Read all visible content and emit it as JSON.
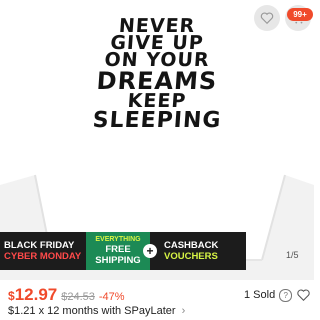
{
  "product_image": {
    "print_lines": [
      "NEVER",
      "GIVE UP",
      "ON YOUR",
      "DREAMS",
      "KEEP",
      "SLEEPING"
    ],
    "page_indicator": "1/5"
  },
  "header": {
    "cart_badge": "99+",
    "icons": [
      "heart-icon",
      "cart-icon"
    ]
  },
  "promo_banner": {
    "event_line1": "BLACK FRIDAY",
    "event_line2": "CYBER MONDAY",
    "shipping_line1": "EVERYTHING",
    "shipping_line2": "FREE",
    "shipping_line3": "SHIPPING",
    "plus": "+",
    "cashback_line1": "CASHBACK",
    "cashback_line2": "VOUCHERS",
    "colors": {
      "background": "#1c1c1c",
      "shipping_bg": "#1c8a55",
      "accent_yellow": "#d8f545",
      "accent_red": "#ff4a4a"
    }
  },
  "price": {
    "currency": "$",
    "current": "12.97",
    "original": "$24.53",
    "discount": "-47%",
    "color": "#f04a2b"
  },
  "sales": {
    "sold": "1 Sold",
    "help_symbol": "?"
  },
  "installment": {
    "text": "$1.21 x 12 months with SPayLater",
    "arrow": "›"
  }
}
